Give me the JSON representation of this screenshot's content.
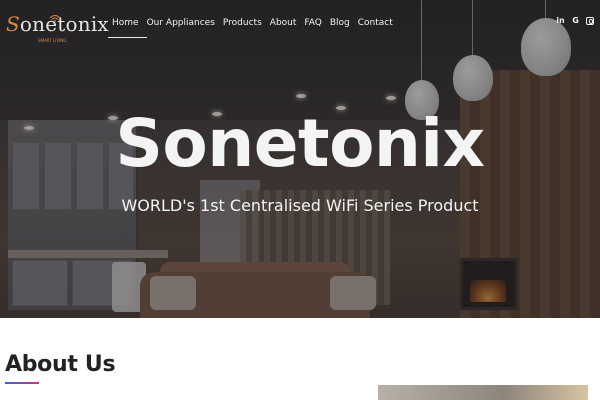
{
  "brand": {
    "name": "Sonetonix",
    "logo_icon": "wifi-icon",
    "colors": {
      "accent": "#cf8c4a",
      "underline_start": "#3b63d6",
      "underline_end": "#d6337a"
    }
  },
  "nav": {
    "items": [
      {
        "label": "Home",
        "active": true
      },
      {
        "label": "Our Appliances",
        "active": false
      },
      {
        "label": "Products",
        "active": false
      },
      {
        "label": "About",
        "active": false
      },
      {
        "label": "FAQ",
        "active": false
      },
      {
        "label": "Blog",
        "active": false
      },
      {
        "label": "Contact",
        "active": false
      }
    ]
  },
  "social": [
    {
      "label": "in",
      "icon": "linkedin-icon"
    },
    {
      "label": "G",
      "icon": "google-icon"
    },
    {
      "label": "",
      "icon": "instagram-icon"
    }
  ],
  "hero": {
    "title": "Sonetonix",
    "subtitle": "WORLD's 1st Centralised WiFi Series Product"
  },
  "about": {
    "heading": "About Us"
  }
}
